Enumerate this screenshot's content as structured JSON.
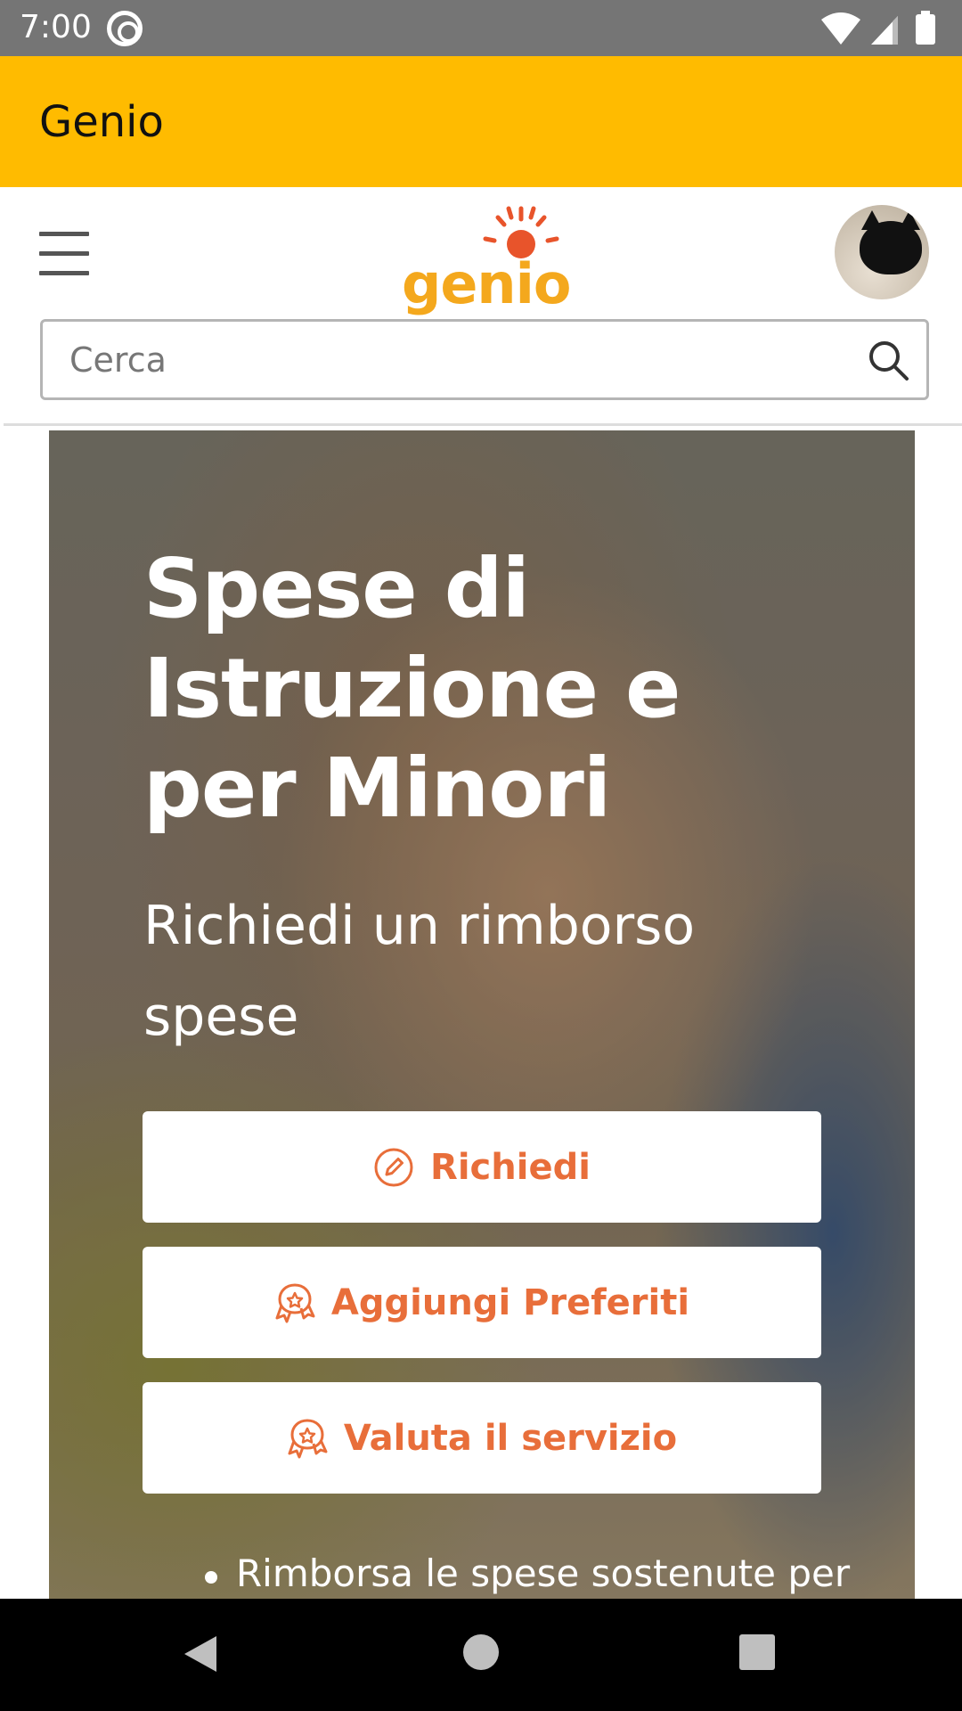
{
  "status_bar": {
    "time": "7:00"
  },
  "app_bar": {
    "title": "Genio"
  },
  "header": {
    "logo_text": "genio",
    "search": {
      "placeholder": "Cerca",
      "value": ""
    }
  },
  "hero": {
    "title": "Spese di Istruzione e per Minori",
    "subtitle": "Richiedi un rimborso spese",
    "buttons": [
      {
        "label": "Richiedi",
        "icon": "pencil-icon"
      },
      {
        "label": "Aggiungi Preferiti",
        "icon": "award-star-icon"
      },
      {
        "label": "Valuta il servizio",
        "icon": "award-star-icon"
      }
    ],
    "bullet": "Rimborsa le spese sostenute per"
  },
  "colors": {
    "app_bar": "#FFBB00",
    "accent": "#E86E3A",
    "logo": "#F4A81D"
  }
}
